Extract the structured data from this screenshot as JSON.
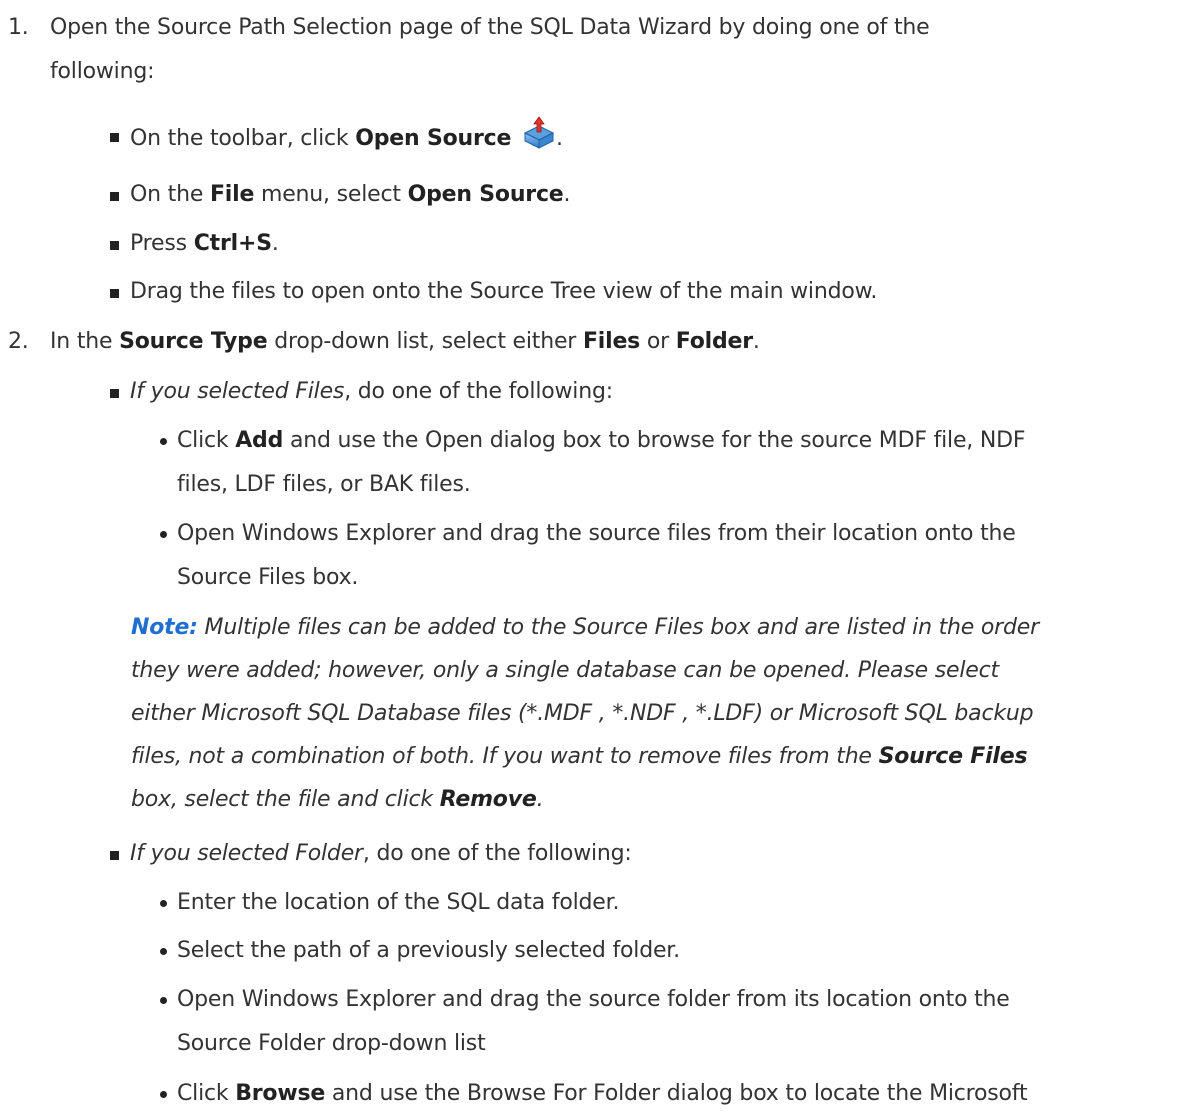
{
  "step1": {
    "number": "1.",
    "line1": "Open the Source Path Selection page of the SQL Data Wizard by doing one of the",
    "line2": "following:",
    "bullets": {
      "b1_pre": "On the toolbar, click ",
      "b1_bold": "Open Source",
      "b1_post": ".",
      "b1_icon": "open-source-icon",
      "b2_pre": "On the ",
      "b2_bold1": "File",
      "b2_mid": " menu, select ",
      "b2_bold2": "Open Source",
      "b2_post": ".",
      "b3_pre": "Press ",
      "b3_bold": "Ctrl+S",
      "b3_post": ".",
      "b4": "Drag the files to open onto the Source Tree view of the main window."
    }
  },
  "step2": {
    "number": "2.",
    "pre": "In the ",
    "bold1": "Source Type",
    "mid1": " drop-down list, select either ",
    "bold2": "Files",
    "mid2": " or ",
    "bold3": "Folder",
    "post": ".",
    "files": {
      "ital": "If you selected Files",
      "rest": ", do one of the following:",
      "d1_pre": "Click ",
      "d1_bold": "Add",
      "d1_line1_rest": " and use the Open dialog box to browse for the source MDF file, NDF",
      "d1_line2": "files, LDF files, or BAK files.",
      "d2_line1": "Open Windows Explorer and drag the source files from their location onto the",
      "d2_line2": "Source Files box.",
      "note_label": "Note:",
      "note_line1": " Multiple files can be added to the Source Files box and are listed in the order",
      "note_line2": "they were added; however, only a single database can be opened. Please select",
      "note_line3": "either Microsoft SQL Database files (*.MDF , *.NDF , *.LDF) or Microsoft SQL backup",
      "note_line4_pre": "files, not a combination of both. If you want to remove files from the ",
      "note_line4_bold": "Source Files",
      "note_line5_pre": "box, select the file and click ",
      "note_line5_bold": "Remove",
      "note_line5_post": "."
    },
    "folder": {
      "ital": "If you selected Folder",
      "rest": ", do one of the following:",
      "d1": "Enter the location of the SQL data folder.",
      "d2": "Select the path of a previously selected folder.",
      "d3_line1": "Open Windows Explorer and drag the source folder from its location onto the",
      "d3_line2": "Source Folder drop-down list",
      "d4_pre": "Click ",
      "d4_bold": "Browse",
      "d4_rest": " and use the Browse For Folder dialog box to locate the Microsoft"
    }
  }
}
